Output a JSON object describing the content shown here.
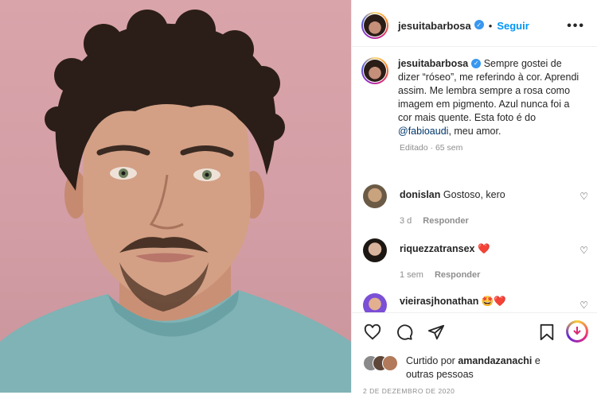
{
  "post": {
    "username": "jesuitabarbosa",
    "follow_label": "Seguir",
    "separator": "•",
    "more_label": "•••",
    "verified_glyph": "✓"
  },
  "caption": {
    "username": "jesuitabarbosa",
    "text_before_mention": "Sempre gostei de dizer “róseo”, me referindo à cor. Aprendi assim. Me lembra sempre a rosa como imagem em pigmento. Azul nunca foi a cor mais quente. Esta foto é do ",
    "mention": "@fabioaudi",
    "text_after_mention": ", meu amor.",
    "meta": "Editado · 65 sem"
  },
  "comments": [
    {
      "username": "donislan",
      "text": "Gostoso, kero",
      "time": "3 d",
      "reply_label": "Responder",
      "avatar_icon": "user-avatar"
    },
    {
      "username": "riquezzatransex",
      "text": "❤️",
      "time": "1 sem",
      "reply_label": "Responder",
      "avatar_icon": "user-avatar"
    },
    {
      "username": "vieirasjhonathan",
      "text": "🤩❤️",
      "time": "",
      "reply_label": "",
      "avatar_icon": "user-avatar"
    }
  ],
  "actions": {
    "like_icon": "heart-icon",
    "comment_icon": "comment-icon",
    "share_icon": "share-icon",
    "save_icon": "bookmark-icon",
    "download_icon": "download-icon"
  },
  "likes": {
    "prefix": "Curtido por ",
    "user": "amandazanachi",
    "suffix": " e",
    "others": "outras pessoas"
  },
  "date": "2 DE DEZEMBRO DE 2020",
  "colors": {
    "photo_background": "#d39ea5",
    "shirt": "#7fb3b6",
    "follow_blue": "#0095f6",
    "verified_blue": "#3897f0",
    "like_heart_red": "#ed4956"
  }
}
